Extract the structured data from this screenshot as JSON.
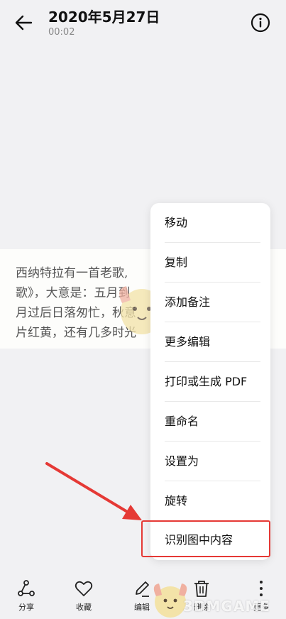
{
  "header": {
    "title": "2020年5月27日",
    "subtitle": "00:02",
    "back_icon": "arrow-left-icon",
    "info_icon": "info-circle-icon"
  },
  "photo": {
    "lines": [
      "西纳特拉有一首老歌,",
      "歌》，大意是：五月到",
      "月过后日落匆忙，秋意",
      "片红黄，还有几多时光"
    ]
  },
  "menu": {
    "items": [
      "移动",
      "复制",
      "添加备注",
      "更多编辑",
      "打印或生成 PDF",
      "重命名",
      "设置为",
      "旋转",
      "识别图中内容"
    ],
    "highlighted_index": 8,
    "highlight_color": "#e53935"
  },
  "toolbar": {
    "items": [
      {
        "label": "分享",
        "icon": "share-icon"
      },
      {
        "label": "收藏",
        "icon": "heart-icon"
      },
      {
        "label": "编辑",
        "icon": "pencil-icon"
      },
      {
        "label": "删除",
        "icon": "trash-icon"
      },
      {
        "label": "更多",
        "icon": "more-vertical-icon"
      }
    ]
  },
  "watermark": "3DMGAME"
}
